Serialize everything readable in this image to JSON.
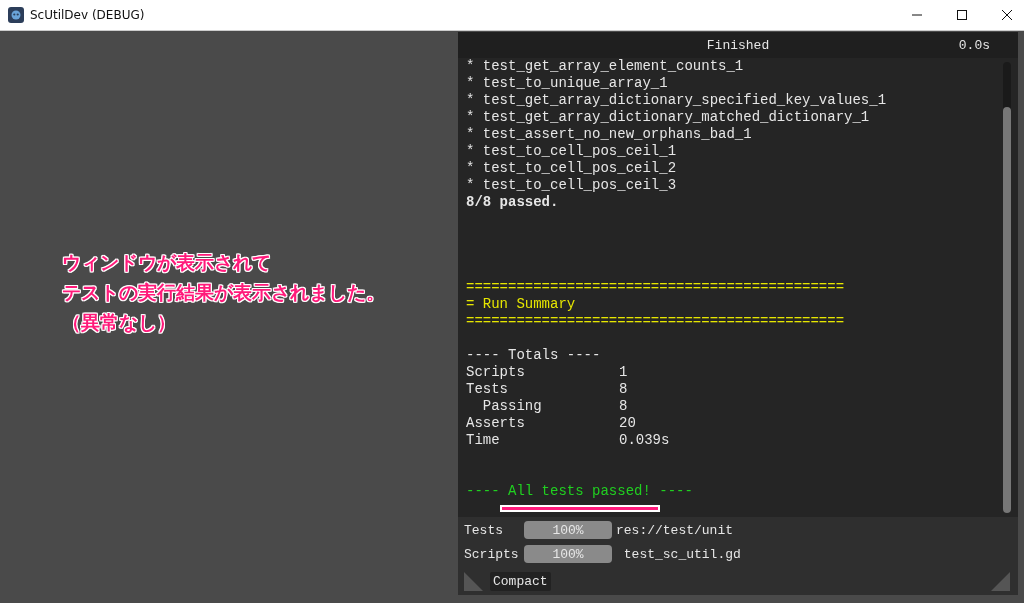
{
  "window": {
    "title": "ScUtilDev (DEBUG)"
  },
  "annotation": {
    "lines": [
      "ウィンドウが表示されて",
      "テストの実行結果が表示されました。",
      "（異常なし）"
    ]
  },
  "panel": {
    "status": "Finished",
    "elapsed": "0.0s",
    "log": [
      {
        "kind": "results",
        "lines": [
          "* test_get_array_element_counts_1",
          "* test_to_unique_array_1",
          "* test_get_array_dictionary_specified_key_values_1",
          "* test_get_array_dictionary_matched_dictionary_1",
          "* test_assert_no_new_orphans_bad_1",
          "* test_to_cell_pos_ceil_1",
          "* test_to_cell_pos_ceil_2",
          "* test_to_cell_pos_ceil_3"
        ]
      },
      {
        "kind": "bold",
        "lines": [
          "8/8 passed."
        ]
      },
      {
        "kind": "summary",
        "lines": [
          "=============================================",
          "= Run Summary",
          "============================================="
        ]
      },
      {
        "kind": "heading",
        "lines": [
          "---- Totals ----"
        ]
      },
      {
        "kind": "totals",
        "rows": [
          {
            "label": "Scripts",
            "value": "1"
          },
          {
            "label": "Tests",
            "value": "8"
          },
          {
            "label": "  Passing",
            "value": "8"
          },
          {
            "label": "Asserts",
            "value": "20"
          },
          {
            "label": "Time",
            "value": "0.039s"
          }
        ]
      },
      {
        "kind": "final",
        "lines": [
          "---- All tests passed! ----"
        ]
      }
    ],
    "progress": [
      {
        "label": "Tests",
        "level": 1,
        "reading": "100%",
        "path": "res://test/unit"
      },
      {
        "label": "Scripts",
        "level": 1,
        "reading": "100%",
        "path": " test_sc_util.gd"
      }
    ],
    "compact_button": "Compact"
  }
}
